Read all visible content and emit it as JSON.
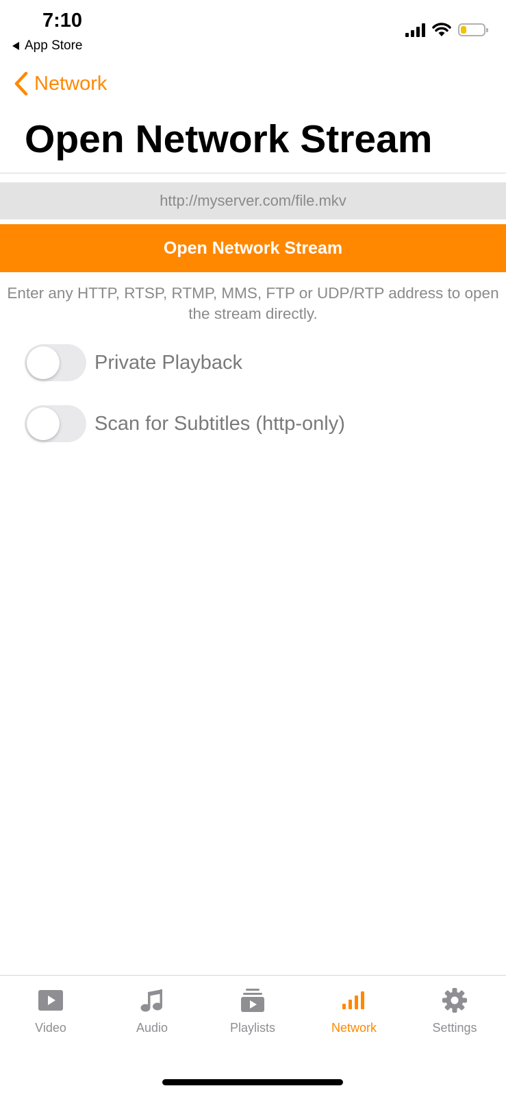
{
  "status_bar": {
    "time": "7:10",
    "back_app": "App Store"
  },
  "nav": {
    "back_label": "Network",
    "title": "Open Network Stream"
  },
  "url_input": {
    "value": "",
    "placeholder": "http://myserver.com/file.mkv"
  },
  "open_button": {
    "label": "Open Network Stream"
  },
  "help_text": "Enter any HTTP, RTSP, RTMP, MMS, FTP or UDP/RTP address to open the stream directly.",
  "toggles": [
    {
      "label": "Private Playback",
      "on": false
    },
    {
      "label": "Scan for Subtitles (http-only)",
      "on": false
    }
  ],
  "tabs": [
    {
      "label": "Video",
      "icon": "video-icon",
      "active": false
    },
    {
      "label": "Audio",
      "icon": "music-note-icon",
      "active": false
    },
    {
      "label": "Playlists",
      "icon": "playlists-icon",
      "active": false
    },
    {
      "label": "Network",
      "icon": "network-bars-icon",
      "active": true
    },
    {
      "label": "Settings",
      "icon": "gear-icon",
      "active": false
    }
  ],
  "colors": {
    "accent": "#ff8800",
    "inactive_tab": "#8e8e93",
    "input_bg": "#e3e3e3",
    "battery_fill": "#f2c300"
  },
  "battery_level": 0.25
}
